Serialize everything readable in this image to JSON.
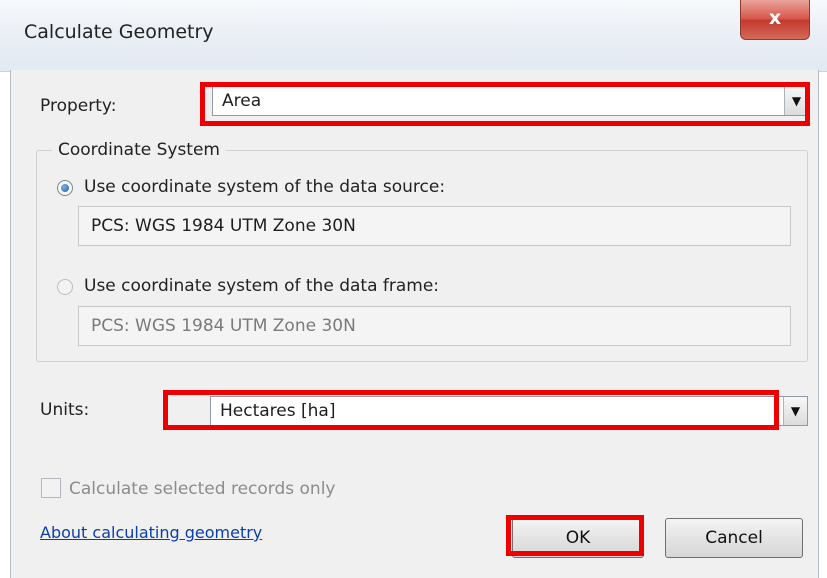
{
  "window": {
    "title": "Calculate Geometry",
    "close_glyph": "x",
    "close_icon": "close-icon"
  },
  "property": {
    "label": "Property:",
    "value": "Area",
    "arrow_icon": "dropdown-arrow-icon"
  },
  "coordinate_system": {
    "title": "Coordinate System",
    "options": [
      {
        "label": "Use coordinate system of the data source:",
        "value": "PCS: WGS 1984 UTM Zone 30N",
        "selected": true,
        "enabled": true
      },
      {
        "label": "Use coordinate system of the data frame:",
        "value": "PCS: WGS 1984 UTM Zone 30N",
        "selected": false,
        "enabled": false
      }
    ]
  },
  "units": {
    "label": "Units:",
    "value": "Hectares [ha]",
    "arrow_icon": "dropdown-arrow-icon"
  },
  "selected_only": {
    "label": "Calculate selected records only",
    "checked": false,
    "enabled": false
  },
  "help_link": "About calculating geometry",
  "buttons": {
    "ok": "OK",
    "cancel": "Cancel"
  },
  "colors": {
    "highlight": "#ee0000",
    "link": "#0b3ea8",
    "close_button": "#c13a2d"
  }
}
